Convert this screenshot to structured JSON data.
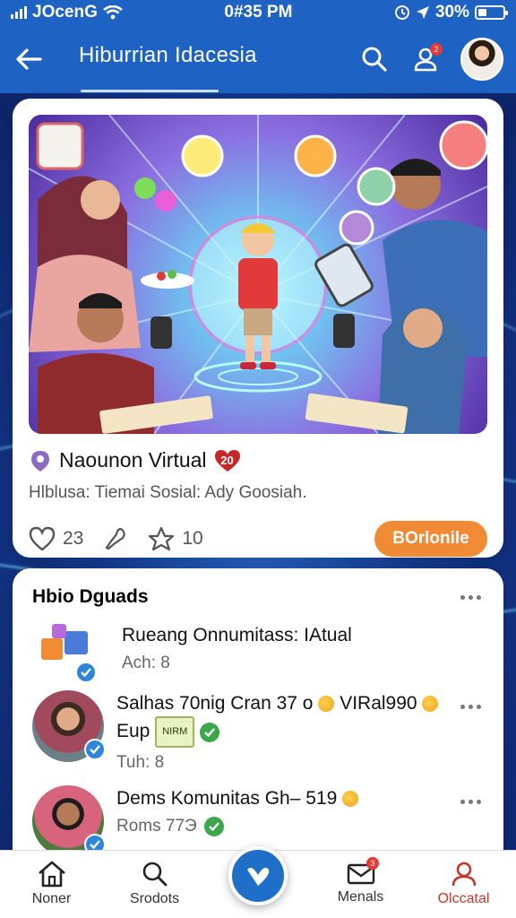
{
  "status_bar": {
    "carrier": "JOcenG",
    "time": "0#35 PM",
    "battery": "30%"
  },
  "header": {
    "title": "Hiburrian Idacesia",
    "notification_count": "2",
    "icons": [
      "back-arrow-icon",
      "search-icon",
      "user-notification-icon",
      "profile-avatar"
    ]
  },
  "feature": {
    "title": "Naounon Virtual",
    "badge": "20",
    "subtitle": "Hlblusa: Tiemai Sosial: Ady Goosiah.",
    "likes": "23",
    "stars": "10",
    "cta_label": "BOrlonile"
  },
  "groups": {
    "title": "Hbio Dguads",
    "items": [
      {
        "name": "Rueang Onnumitass: IAtual",
        "meta": "Ach: 8"
      },
      {
        "name_parts": [
          "Salhas 70nig Cran 37 o",
          "VIRal990",
          "Eup"
        ],
        "chip": "NIRM",
        "meta": "Tuh: 8"
      },
      {
        "name": "Dems Komunitas Gh– 519",
        "meta": "Roms 77Э"
      }
    ]
  },
  "bottom_nav": {
    "items": [
      {
        "label": "Noner",
        "icon": "home-icon"
      },
      {
        "label": "Srodots",
        "icon": "search-icon"
      },
      {
        "label": "Menals",
        "icon": "mail-icon",
        "badge": "3"
      },
      {
        "label": "Olccatal",
        "icon": "profile-icon"
      }
    ]
  },
  "colors": {
    "header_blue": "#1e63c4",
    "accent_orange": "#f08a35",
    "verified_blue": "#2f86d9",
    "active_red": "#c0392b"
  }
}
